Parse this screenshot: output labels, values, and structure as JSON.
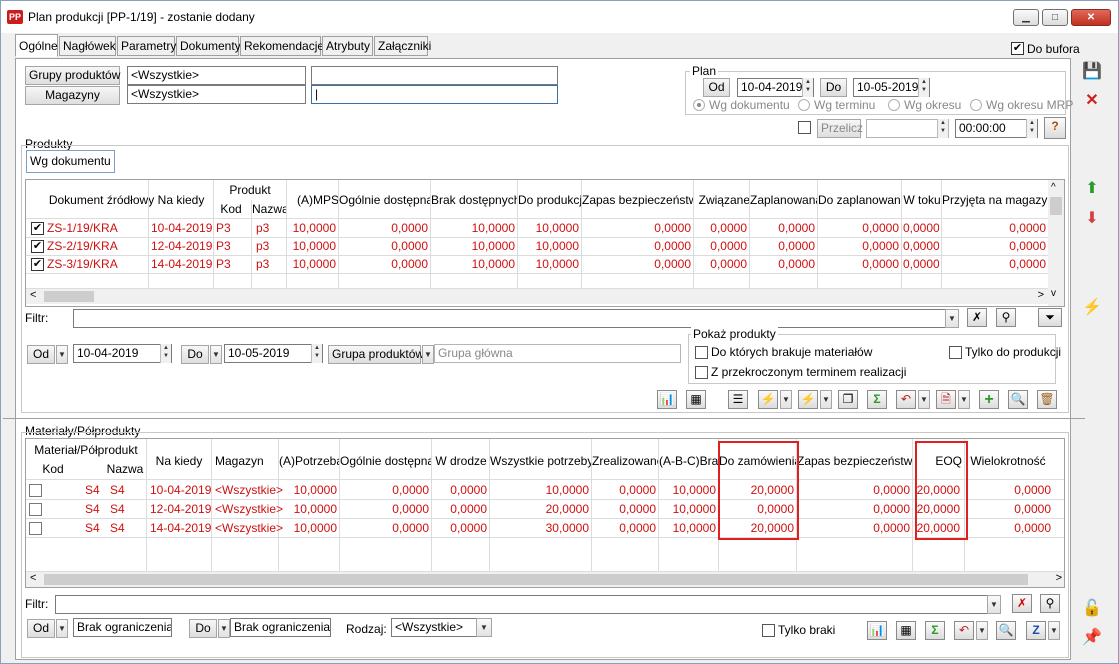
{
  "window": {
    "title": "Plan produkcji [PP-1/19] - zostanie dodany",
    "logo": "PP"
  },
  "tabs": [
    "Ogólne",
    "Nagłówek",
    "Parametry",
    "Dokumenty",
    "Rekomendacje",
    "Atrybuty",
    "Załączniki"
  ],
  "header": {
    "do_bufora": "Do bufora",
    "grupy_btn": "Grupy produktów",
    "grupy_value": "<Wszystkie>",
    "magazyny_btn": "Magazyny",
    "magazyny_value": "<Wszystkie>"
  },
  "plan": {
    "title": "Plan",
    "od_label": "Od",
    "od_value": "10-04-2019",
    "do_label": "Do",
    "do_value": "10-05-2019",
    "radios": [
      "Wg dokumentu",
      "Wg terminu",
      "Wg okresu",
      "Wg okresu MRP"
    ],
    "przelicz": "Przelicz",
    "time": "00:00:00"
  },
  "produkty": {
    "title": "Produkty",
    "subtab": "Wg dokumentu",
    "headers": {
      "dokument": "Dokument źródłowy",
      "na_kiedy": "Na kiedy",
      "produkt": "Produkt",
      "kod": "Kod",
      "nazwa": "Nazwa",
      "mps": "(A)MPS",
      "ogolnie": "Ogólnie dostępna",
      "brak": "Brak dostępnych",
      "do_produkcji": "Do produkcji",
      "zapas": "Zapas bezpieczeństwa",
      "zwiazane": "Związane",
      "zaplanowana": "Zaplanowana",
      "do_zaplanowania": "Do zaplanowania",
      "w_toku": "W toku",
      "przyjeta": "Przyjęta na magazyn"
    },
    "rows": [
      {
        "dok": "ZS-1/19/KRA",
        "data": "10-04-2019",
        "kod": "P3",
        "nazwa": "p3",
        "mps": "10,0000",
        "ogolnie": "0,0000",
        "brak": "10,0000",
        "do_prod": "10,0000",
        "zapas": "0,0000",
        "zwiazane": "0,0000",
        "zaplan": "0,0000",
        "do_zaplan": "0,0000",
        "w_toku": "0,0000",
        "przyjeta": "0,0000"
      },
      {
        "dok": "ZS-2/19/KRA",
        "data": "12-04-2019",
        "kod": "P3",
        "nazwa": "p3",
        "mps": "10,0000",
        "ogolnie": "0,0000",
        "brak": "10,0000",
        "do_prod": "10,0000",
        "zapas": "0,0000",
        "zwiazane": "0,0000",
        "zaplan": "0,0000",
        "do_zaplan": "0,0000",
        "w_toku": "0,0000",
        "przyjeta": "0,0000"
      },
      {
        "dok": "ZS-3/19/KRA",
        "data": "14-04-2019",
        "kod": "P3",
        "nazwa": "p3",
        "mps": "10,0000",
        "ogolnie": "0,0000",
        "brak": "10,0000",
        "do_prod": "10,0000",
        "zapas": "0,0000",
        "zwiazane": "0,0000",
        "zaplan": "0,0000",
        "do_zaplan": "0,0000",
        "w_toku": "0,0000",
        "przyjeta": "0,0000"
      }
    ],
    "filtr_label": "Filtr:",
    "od_label": "Od",
    "od_value": "10-04-2019",
    "do_label": "Do",
    "do_value": "10-05-2019",
    "grupa_btn": "Grupa produktów",
    "grupa_value": "Grupa główna",
    "pokaz_title": "Pokaż produkty",
    "pokaz_opts": [
      "Do których brakuje materiałów",
      "Tylko do produkcji",
      "Z przekroczonym terminem realizacji"
    ]
  },
  "materialy": {
    "title": "Materiały/Półprodukty",
    "headers": {
      "material": "Materiał/Półprodukt",
      "kod": "Kod",
      "nazwa": "Nazwa",
      "na_kiedy": "Na kiedy",
      "magazyn": "Magazyn",
      "potrzeba": "(A)Potrzeba",
      "ogolnie": "Ogólnie dostępna",
      "w_drodze": "W drodze",
      "wszystkie": "Wszystkie potrzeby",
      "zrealizowano": "Zrealizowano",
      "abc": "(A-B-C)Braki",
      "do_zamowienia": "Do zamówienia",
      "zapas": "Zapas bezpieczeństwa",
      "eoq": "EOQ",
      "wielokrotnosc": "Wielokrotność"
    },
    "rows": [
      {
        "kod": "S4",
        "nazwa": "S4",
        "data": "10-04-2019",
        "magazyn": "<Wszystkie>",
        "potrzeba": "10,0000",
        "ogolnie": "0,0000",
        "w_drodze": "0,0000",
        "wszystkie": "10,0000",
        "zreal": "0,0000",
        "abc": "10,0000",
        "do_zam": "20,0000",
        "zapas": "0,0000",
        "eoq": "20,0000",
        "wiel": "0,0000"
      },
      {
        "kod": "S4",
        "nazwa": "S4",
        "data": "12-04-2019",
        "magazyn": "<Wszystkie>",
        "potrzeba": "10,0000",
        "ogolnie": "0,0000",
        "w_drodze": "0,0000",
        "wszystkie": "20,0000",
        "zreal": "0,0000",
        "abc": "10,0000",
        "do_zam": "0,0000",
        "zapas": "0,0000",
        "eoq": "20,0000",
        "wiel": "0,0000"
      },
      {
        "kod": "S4",
        "nazwa": "S4",
        "data": "14-04-2019",
        "magazyn": "<Wszystkie>",
        "potrzeba": "10,0000",
        "ogolnie": "0,0000",
        "w_drodze": "0,0000",
        "wszystkie": "30,0000",
        "zreal": "0,0000",
        "abc": "10,0000",
        "do_zam": "20,0000",
        "zapas": "0,0000",
        "eoq": "20,0000",
        "wiel": "0,0000"
      }
    ],
    "filtr_label": "Filtr:",
    "od_label": "Od",
    "od_value": "Brak ograniczenia",
    "do_label": "Do",
    "do_value": "Brak ograniczenia",
    "rodzaj_label": "Rodzaj:",
    "rodzaj_value": "<Wszystkie>",
    "tylko_braki": "Tylko braki"
  },
  "colors": {
    "row_text": "#d01010",
    "highlight_box": "#e02020"
  }
}
